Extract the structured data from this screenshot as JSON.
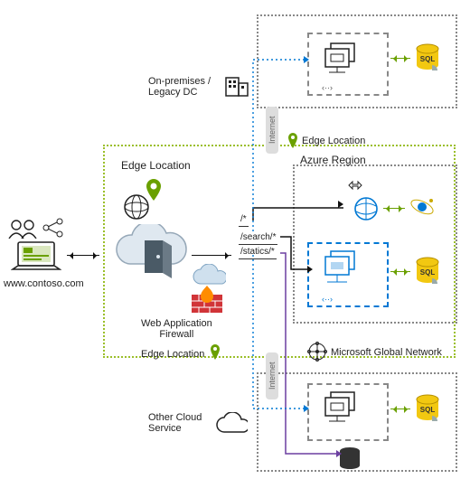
{
  "domain": "www.contoso.com",
  "labels": {
    "onprem": "On-premises /\nLegacy DC",
    "edge_location": "Edge Location",
    "azure_region": "Azure Region",
    "waf": "Web Application\nFirewall",
    "msgn": "Microsoft Global Network",
    "other_cloud": "Other Cloud\nService",
    "internet": "Internet"
  },
  "path_rules": {
    "root": "/*",
    "search": "/search/*",
    "statics": "/statics/*"
  },
  "icons": {
    "users": "users-icon",
    "laptop": "laptop-icon",
    "share": "share-icon",
    "building": "building-icon",
    "location_pin": "location-pin-icon",
    "globe": "globe-icon",
    "cloud_door": "cloud-front-door-icon",
    "cloud": "cloud-icon",
    "firewall": "firewall-icon",
    "network": "network-globe-icon",
    "servers": "server-group-icon",
    "sql": "sql-database-icon",
    "web": "webapp-icon",
    "cosmos": "cosmos-icon",
    "storage": "storage-icon",
    "scale": "autoscale-icon"
  },
  "colors": {
    "green": "#9bbf2a",
    "blue": "#0078d4",
    "grey": "#888888",
    "purple": "#6b3fa0",
    "sql_yellow": "#f2c811",
    "firewall_red": "#d13438"
  },
  "architecture": {
    "client": {
      "url": "www.contoso.com",
      "components": [
        "users",
        "laptop",
        "share-graph"
      ]
    },
    "edge": {
      "label": "Edge Location",
      "components": [
        "location-pin",
        "globe",
        "cloud-front-door",
        "web-application-firewall"
      ],
      "routes": [
        {
          "match": "/*",
          "target": "azure-region/web-app"
        },
        {
          "match": "/search/*",
          "target": "azure-region/server-group"
        },
        {
          "match": "/statics/*",
          "target": "other-cloud/storage"
        }
      ]
    },
    "backends": [
      {
        "name": "On-premises / Legacy DC",
        "via": "Internet",
        "components": [
          "server-group",
          "sql-database"
        ]
      },
      {
        "name": "Azure Region",
        "via": "Microsoft Global Network",
        "components": [
          "autoscale",
          "web-app",
          "cosmos-db",
          "server-group",
          "sql-database"
        ]
      },
      {
        "name": "Other Cloud Service",
        "via": "Internet",
        "components": [
          "server-group",
          "sql-database",
          "storage"
        ]
      }
    ],
    "extra_edge_location_markers": 2
  }
}
